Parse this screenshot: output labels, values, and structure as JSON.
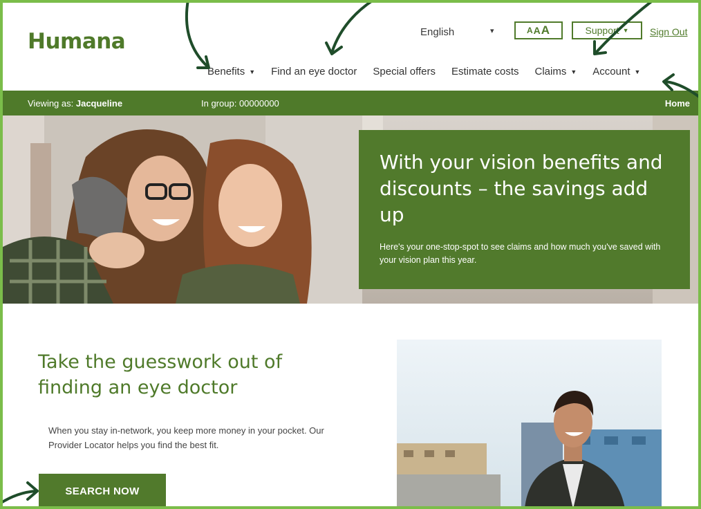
{
  "brand": {
    "logo_text": "Humana",
    "color": "#4f7a2a",
    "accent_frame": "#7bbd4a"
  },
  "utility": {
    "language": "English",
    "text_size_label": [
      "A",
      "A",
      "A"
    ],
    "support_label": "Support",
    "signout_label": "Sign Out"
  },
  "nav": {
    "items": [
      {
        "label": "Benefits",
        "dropdown": true
      },
      {
        "label": "Find an eye doctor",
        "dropdown": false
      },
      {
        "label": "Special offers",
        "dropdown": false
      },
      {
        "label": "Estimate costs",
        "dropdown": false
      },
      {
        "label": "Claims",
        "dropdown": true
      },
      {
        "label": "Account",
        "dropdown": true
      }
    ]
  },
  "viewing_bar": {
    "viewing_prefix": "Viewing as: ",
    "viewing_name": "Jacqueline",
    "group_prefix": "In group: ",
    "group_id": "00000000",
    "home_label": "Home"
  },
  "hero": {
    "title": "With your vision benefits and discounts – the savings add up",
    "subtitle": "Here's your one-stop-spot to see claims and how much you've saved with your vision plan this year."
  },
  "section": {
    "title": "Take the guesswork out of finding an eye doctor",
    "body": "When you stay in-network, you keep more money in your pocket. Our Provider Locator helps you find the best fit.",
    "button_label": "SEARCH NOW"
  },
  "icons": [
    "caret-down-icon",
    "annotation-arrow-icon"
  ]
}
